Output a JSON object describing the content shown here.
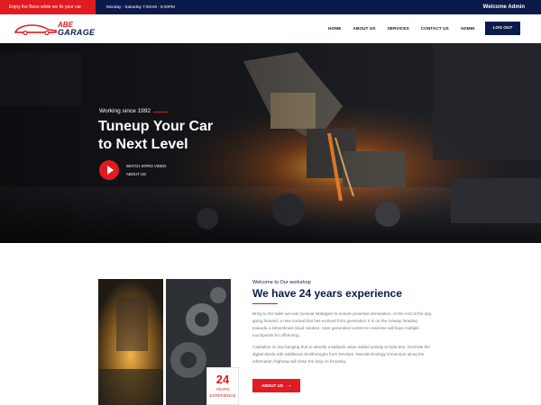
{
  "topbar": {
    "promo": "Enjoy the Beso while we fix your car",
    "hours": "Monday - Saturday 7:00AM - 6:00PM",
    "welcome": "Welcome Admin"
  },
  "header": {
    "logo_top": "ABE",
    "logo_bottom": "GARAGE",
    "nav": [
      "HOME",
      "ABOUT US",
      "SERVICES",
      "CONTACT US",
      "ADMIN"
    ],
    "logout": "LOG OUT"
  },
  "hero": {
    "since": "Working since 1992",
    "title_line1": "Tuneup Your Car",
    "title_line2": "to Next Level",
    "watch": "WATCH INTRO VIDEO",
    "about": "ABOUT US"
  },
  "welcome": {
    "small": "Welcome to Our workshop",
    "title": "We have 24 years experience",
    "para1": "Bring to the table win-win survival strategies to ensure proactive domination. At the end of the day, going forward, a new normal that has evolved from generation X is on the runway heading towards a streamlined cloud solution. User generated content in real-time will have multiple touchpoints for offshoring.",
    "para2": "Capitalize on low hanging fruit to identify a ballpark value added activity to beta test. Override the digital divide with additional clickthroughs from DevOps. Nanotechnology immersion along the information highway will close the loop on focusing.",
    "badge_num": "24",
    "badge_l1": "YEARS",
    "badge_l2": "EXPERIENCE",
    "button": "ABOUT US"
  },
  "colors": {
    "navy": "#0b1a4a",
    "red": "#e01b22"
  }
}
